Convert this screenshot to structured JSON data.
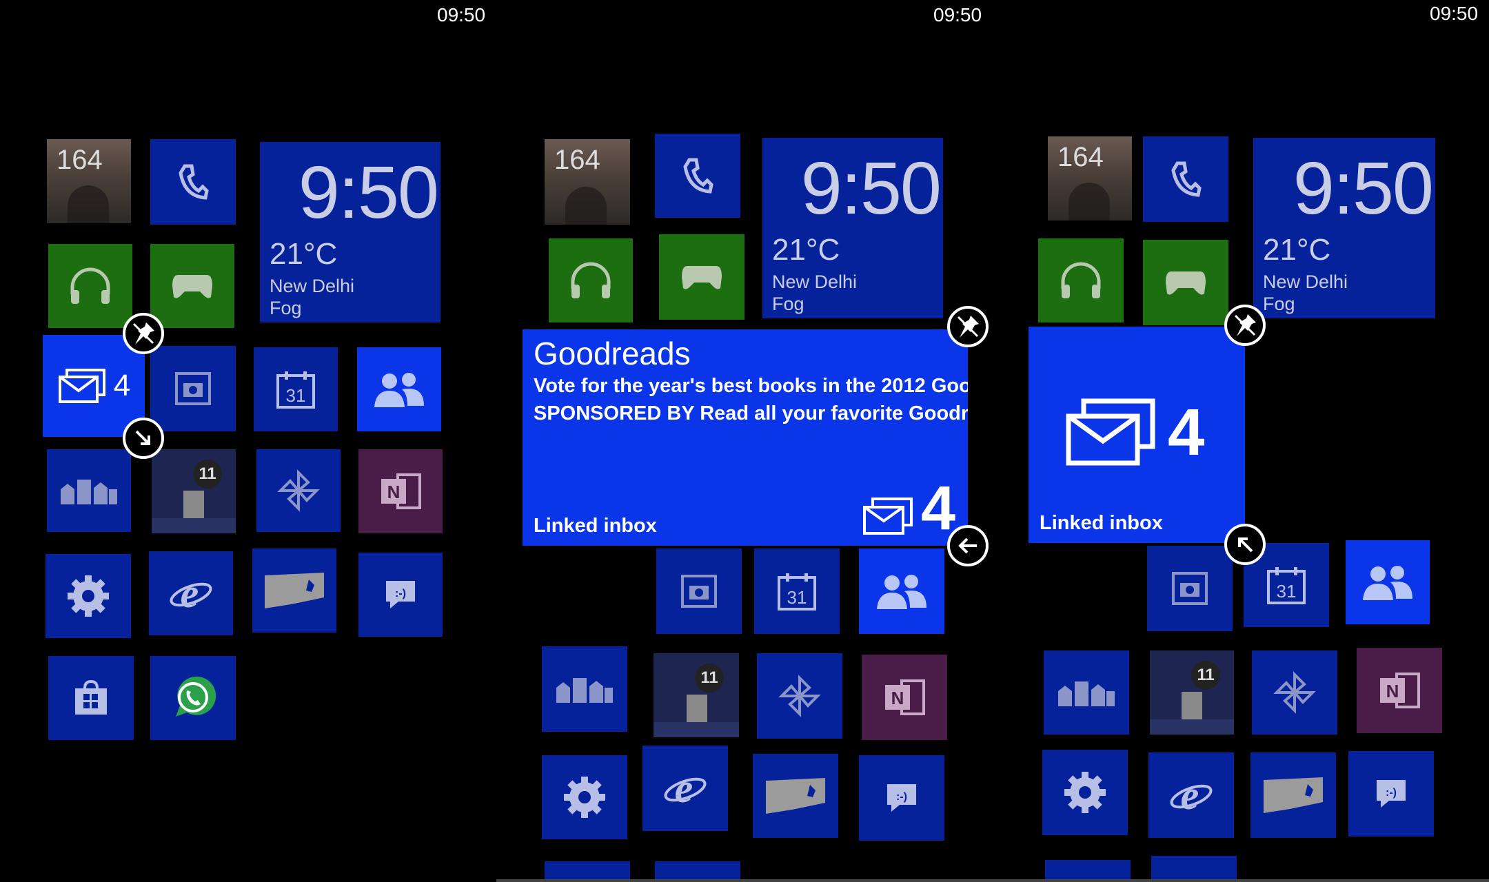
{
  "status_time": "09:50",
  "clock": {
    "time": "9:50",
    "temp": "21°C",
    "city": "New Delhi",
    "condition": "Fog"
  },
  "photos_count": "164",
  "mail_count": "4",
  "news_badge": "11",
  "calendar_day": "31",
  "mail_tile": {
    "label": "Linked inbox",
    "sender": "Goodreads",
    "line1": "Vote for the year's best books in the 2012 Goo",
    "line2": "SPONSORED BY Read all your favorite Goodrea"
  },
  "colors": {
    "tile_dim": "#06229a",
    "tile_bright": "#0a35e8",
    "xbox_green": "#1c6e10",
    "onenote_purple": "#4a1c48"
  }
}
